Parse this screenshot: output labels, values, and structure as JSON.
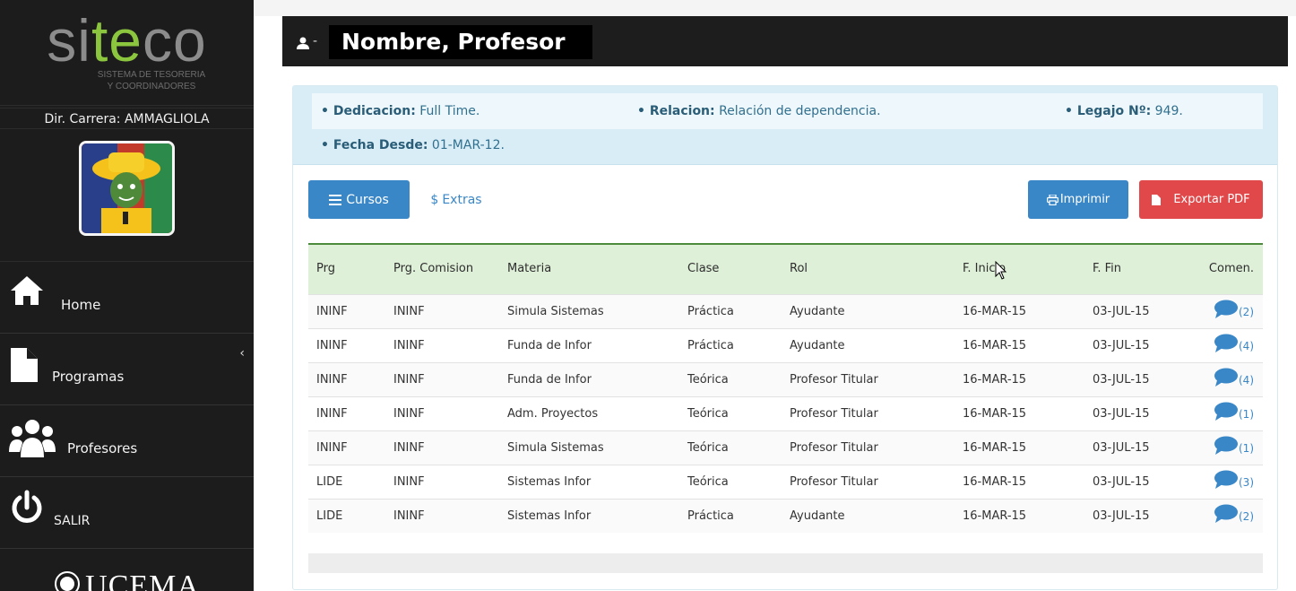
{
  "sidebar": {
    "logo_prefix": "si",
    "logo_accent": "te",
    "logo_suffix": "co",
    "logo_subtitle_1": "SISTEMA DE TESORERIA",
    "logo_subtitle_2": "Y COORDINADORES",
    "director": "Dir. Carrera: AMMAGLIOLA",
    "nav": [
      {
        "label": "Home",
        "icon": "home-icon"
      },
      {
        "label": "Programas",
        "icon": "document-icon"
      },
      {
        "label": "Profesores",
        "icon": "users-icon"
      },
      {
        "label": "SALIR",
        "icon": "power-icon"
      }
    ],
    "collapse_glyph": "‹",
    "footer_logo": "UCEMA"
  },
  "header": {
    "separator": "-",
    "title": "Nombre, Profesor"
  },
  "info": {
    "dedicacion_label": "• Dedicacion:",
    "dedicacion_value": "Full Time.",
    "relacion_label": "• Relacion:",
    "relacion_value": "Relación de dependencia.",
    "legajo_label": "• Legajo Nº:",
    "legajo_value": "949.",
    "fecha_label": "• Fecha Desde:",
    "fecha_value": "01-MAR-12."
  },
  "tabs": {
    "cursos": "Cursos",
    "extras": "Extras"
  },
  "actions": {
    "imprimir": "Imprimir",
    "exportar": "Exportar PDF"
  },
  "table": {
    "headers": [
      "Prg",
      "Prg. Comision",
      "Materia",
      "Clase",
      "Rol",
      "F. Inicio",
      "F. Fin",
      "Comen."
    ],
    "rows": [
      {
        "prg": "ININF",
        "comision": "ININF",
        "materia": "Simula Sistemas",
        "clase": "Práctica",
        "rol": "Ayudante",
        "inicio": "16-MAR-15",
        "fin": "03-JUL-15",
        "comentarios": "(2)"
      },
      {
        "prg": "ININF",
        "comision": "ININF",
        "materia": "Funda de Infor",
        "clase": "Práctica",
        "rol": "Ayudante",
        "inicio": "16-MAR-15",
        "fin": "03-JUL-15",
        "comentarios": "(4)"
      },
      {
        "prg": "ININF",
        "comision": "ININF",
        "materia": "Funda de Infor",
        "clase": "Teórica",
        "rol": "Profesor Titular",
        "inicio": "16-MAR-15",
        "fin": "03-JUL-15",
        "comentarios": "(4)"
      },
      {
        "prg": "ININF",
        "comision": "ININF",
        "materia": "Adm. Proyectos",
        "clase": "Teórica",
        "rol": "Profesor Titular",
        "inicio": "16-MAR-15",
        "fin": "03-JUL-15",
        "comentarios": "(1)"
      },
      {
        "prg": "ININF",
        "comision": "ININF",
        "materia": "Simula Sistemas",
        "clase": "Teórica",
        "rol": "Profesor Titular",
        "inicio": "16-MAR-15",
        "fin": "03-JUL-15",
        "comentarios": "(1)"
      },
      {
        "prg": "LIDE",
        "comision": "ININF",
        "materia": "Sistemas Infor",
        "clase": "Teórica",
        "rol": "Profesor Titular",
        "inicio": "16-MAR-15",
        "fin": "03-JUL-15",
        "comentarios": "(3)"
      },
      {
        "prg": "LIDE",
        "comision": "ININF",
        "materia": "Sistemas Infor",
        "clase": "Práctica",
        "rol": "Ayudante",
        "inicio": "16-MAR-15",
        "fin": "03-JUL-15",
        "comentarios": "(2)"
      }
    ]
  },
  "colors": {
    "sidebar_bg": "#1c1c1c",
    "accent_green": "#8cc63f",
    "primary_blue": "#3a87c8",
    "danger_red": "#e0484a",
    "info_bg": "#d9edf7",
    "table_header_bg": "#dff0d8"
  }
}
